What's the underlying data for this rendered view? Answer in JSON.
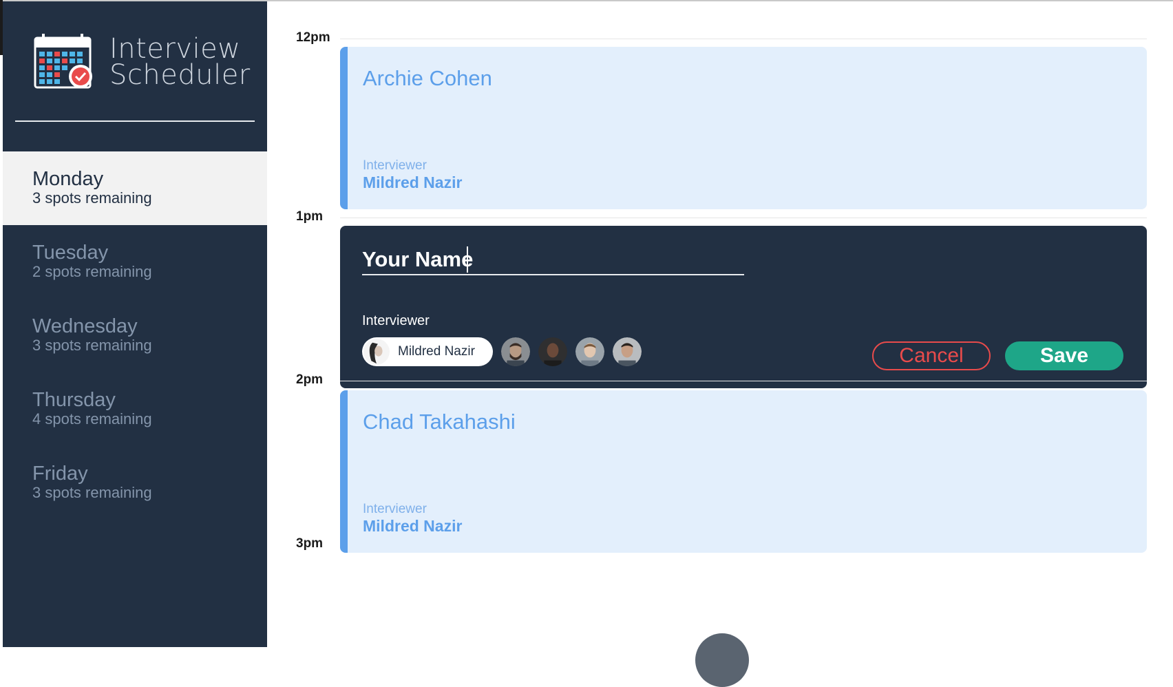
{
  "app": {
    "title_line1": "Interview",
    "title_line2": "Scheduler",
    "logo_icon": "calendar-check-icon"
  },
  "sidebar": {
    "days": [
      {
        "name": "Monday",
        "spots": "3 spots remaining",
        "selected": true
      },
      {
        "name": "Tuesday",
        "spots": "2 spots remaining",
        "selected": false
      },
      {
        "name": "Wednesday",
        "spots": "3 spots remaining",
        "selected": false
      },
      {
        "name": "Thursday",
        "spots": "4 spots remaining",
        "selected": false
      },
      {
        "name": "Friday",
        "spots": "3 spots remaining",
        "selected": false
      }
    ]
  },
  "schedule": {
    "times": [
      "12pm",
      "1pm",
      "2pm",
      "3pm"
    ],
    "appointments": [
      {
        "student": "Archie Cohen",
        "interviewer_label": "Interviewer",
        "interviewer": "Mildred Nazir"
      },
      {
        "student": "Chad Takahashi",
        "interviewer_label": "Interviewer",
        "interviewer": "Mildred Nazir"
      }
    ],
    "form": {
      "name_value": "Your Name",
      "interviewer_label": "Interviewer",
      "selected_interviewer": "Mildred Nazir",
      "cancel_label": "Cancel",
      "save_label": "Save"
    }
  },
  "colors": {
    "sidebar_bg": "#223043",
    "appointment_bg": "#e3effc",
    "appointment_accent": "#5c9fea",
    "cancel": "#e94b4b",
    "save": "#1ea688"
  }
}
